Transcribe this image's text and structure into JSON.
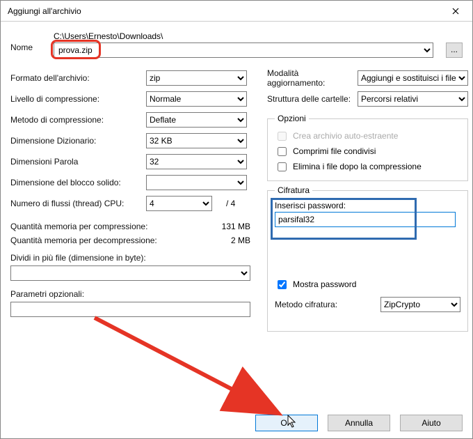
{
  "window": {
    "title": "Aggiungi all'archivio"
  },
  "name": {
    "label": "Nome",
    "path": "C:\\Users\\Ernesto\\Downloads\\",
    "value": "prova.zip",
    "browse": "..."
  },
  "left": {
    "format": {
      "label": "Formato dell'archivio:",
      "value": "zip"
    },
    "level": {
      "label": "Livello di compressione:",
      "value": "Normale"
    },
    "method": {
      "label": "Metodo di compressione:",
      "value": "Deflate"
    },
    "dict": {
      "label": "Dimensione Dizionario:",
      "value": "32 KB"
    },
    "word": {
      "label": "Dimensioni Parola",
      "value": "32"
    },
    "solid": {
      "label": "Dimensione del blocco solido:",
      "value": ""
    },
    "threads": {
      "label": "Numero di flussi (thread) CPU:",
      "value": "4",
      "max": "/ 4"
    },
    "mem_comp": {
      "label": "Quantità memoria per compressione:",
      "value": "131 MB"
    },
    "mem_decomp": {
      "label": "Quantità memoria per decompressione:",
      "value": "2 MB"
    },
    "split": {
      "label": "Dividi in più file (dimensione in byte):"
    },
    "params": {
      "label": "Parametri opzionali:"
    }
  },
  "right": {
    "update": {
      "label": "Modalità aggiornamento:",
      "value": "Aggiungi e sostituisci i file"
    },
    "paths": {
      "label": "Struttura delle cartelle:",
      "value": "Percorsi relativi"
    },
    "options": {
      "legend": "Opzioni",
      "sfx": "Crea archivio auto-estraente",
      "shared": "Comprimi file condivisi",
      "delete": "Elimina i file dopo la compressione"
    },
    "encryption": {
      "legend": "Cifratura",
      "pwd_label": "Inserisci password:",
      "pwd_value": "parsifal32",
      "show": "Mostra password",
      "method_label": "Metodo cifratura:",
      "method_value": "ZipCrypto"
    }
  },
  "buttons": {
    "ok": "OK",
    "cancel": "Annulla",
    "help": "Aiuto"
  }
}
